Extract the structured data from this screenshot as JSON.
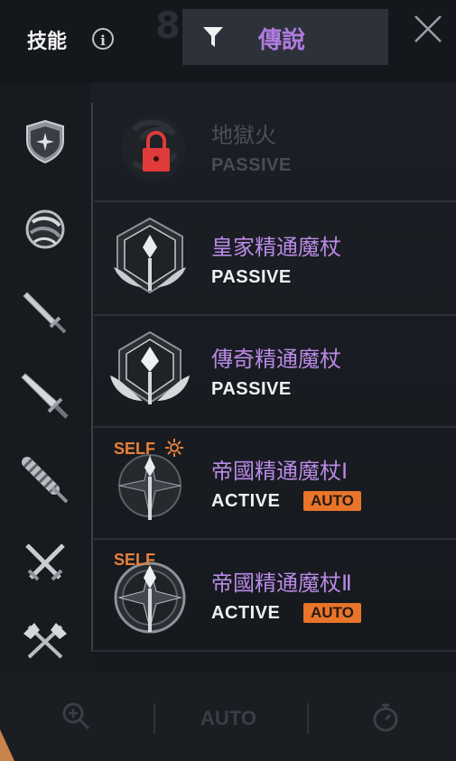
{
  "header": {
    "title": "技能",
    "filter_label": "傳說",
    "ghost_number": "8"
  },
  "icons": {
    "info": "info-icon",
    "filter": "filter-icon",
    "close": "close-icon",
    "lock": "lock-icon",
    "zoom": "zoom-in-icon",
    "timer": "stopwatch-icon",
    "self_burst": "sun-burst-icon"
  },
  "categories": [
    {
      "name": "shield-star-icon"
    },
    {
      "name": "orb-icon"
    },
    {
      "name": "sword-icon"
    },
    {
      "name": "greatsword-icon"
    },
    {
      "name": "spiked-club-icon"
    },
    {
      "name": "crossed-swords-icon"
    },
    {
      "name": "crossed-axes-icon"
    }
  ],
  "skills": [
    {
      "name": "地獄火",
      "type": "PASSIVE",
      "locked": true
    },
    {
      "name": "皇家精通魔杖",
      "type": "PASSIVE"
    },
    {
      "name": "傳奇精通魔杖",
      "type": "PASSIVE"
    },
    {
      "name": "帝國精通魔杖Ⅰ",
      "type": "ACTIVE",
      "self_tag": "SELF",
      "badge": "AUTO"
    },
    {
      "name": "帝國精通魔杖Ⅱ",
      "type": "ACTIVE",
      "self_tag": "SELF",
      "badge": "AUTO"
    }
  ],
  "bottom": {
    "auto_label": "AUTO"
  },
  "colors": {
    "accent_purple": "#b98ae6",
    "auto_orange": "#e8752a",
    "lock_red": "#e03a3a",
    "panel_bg": "#1a1d22"
  }
}
